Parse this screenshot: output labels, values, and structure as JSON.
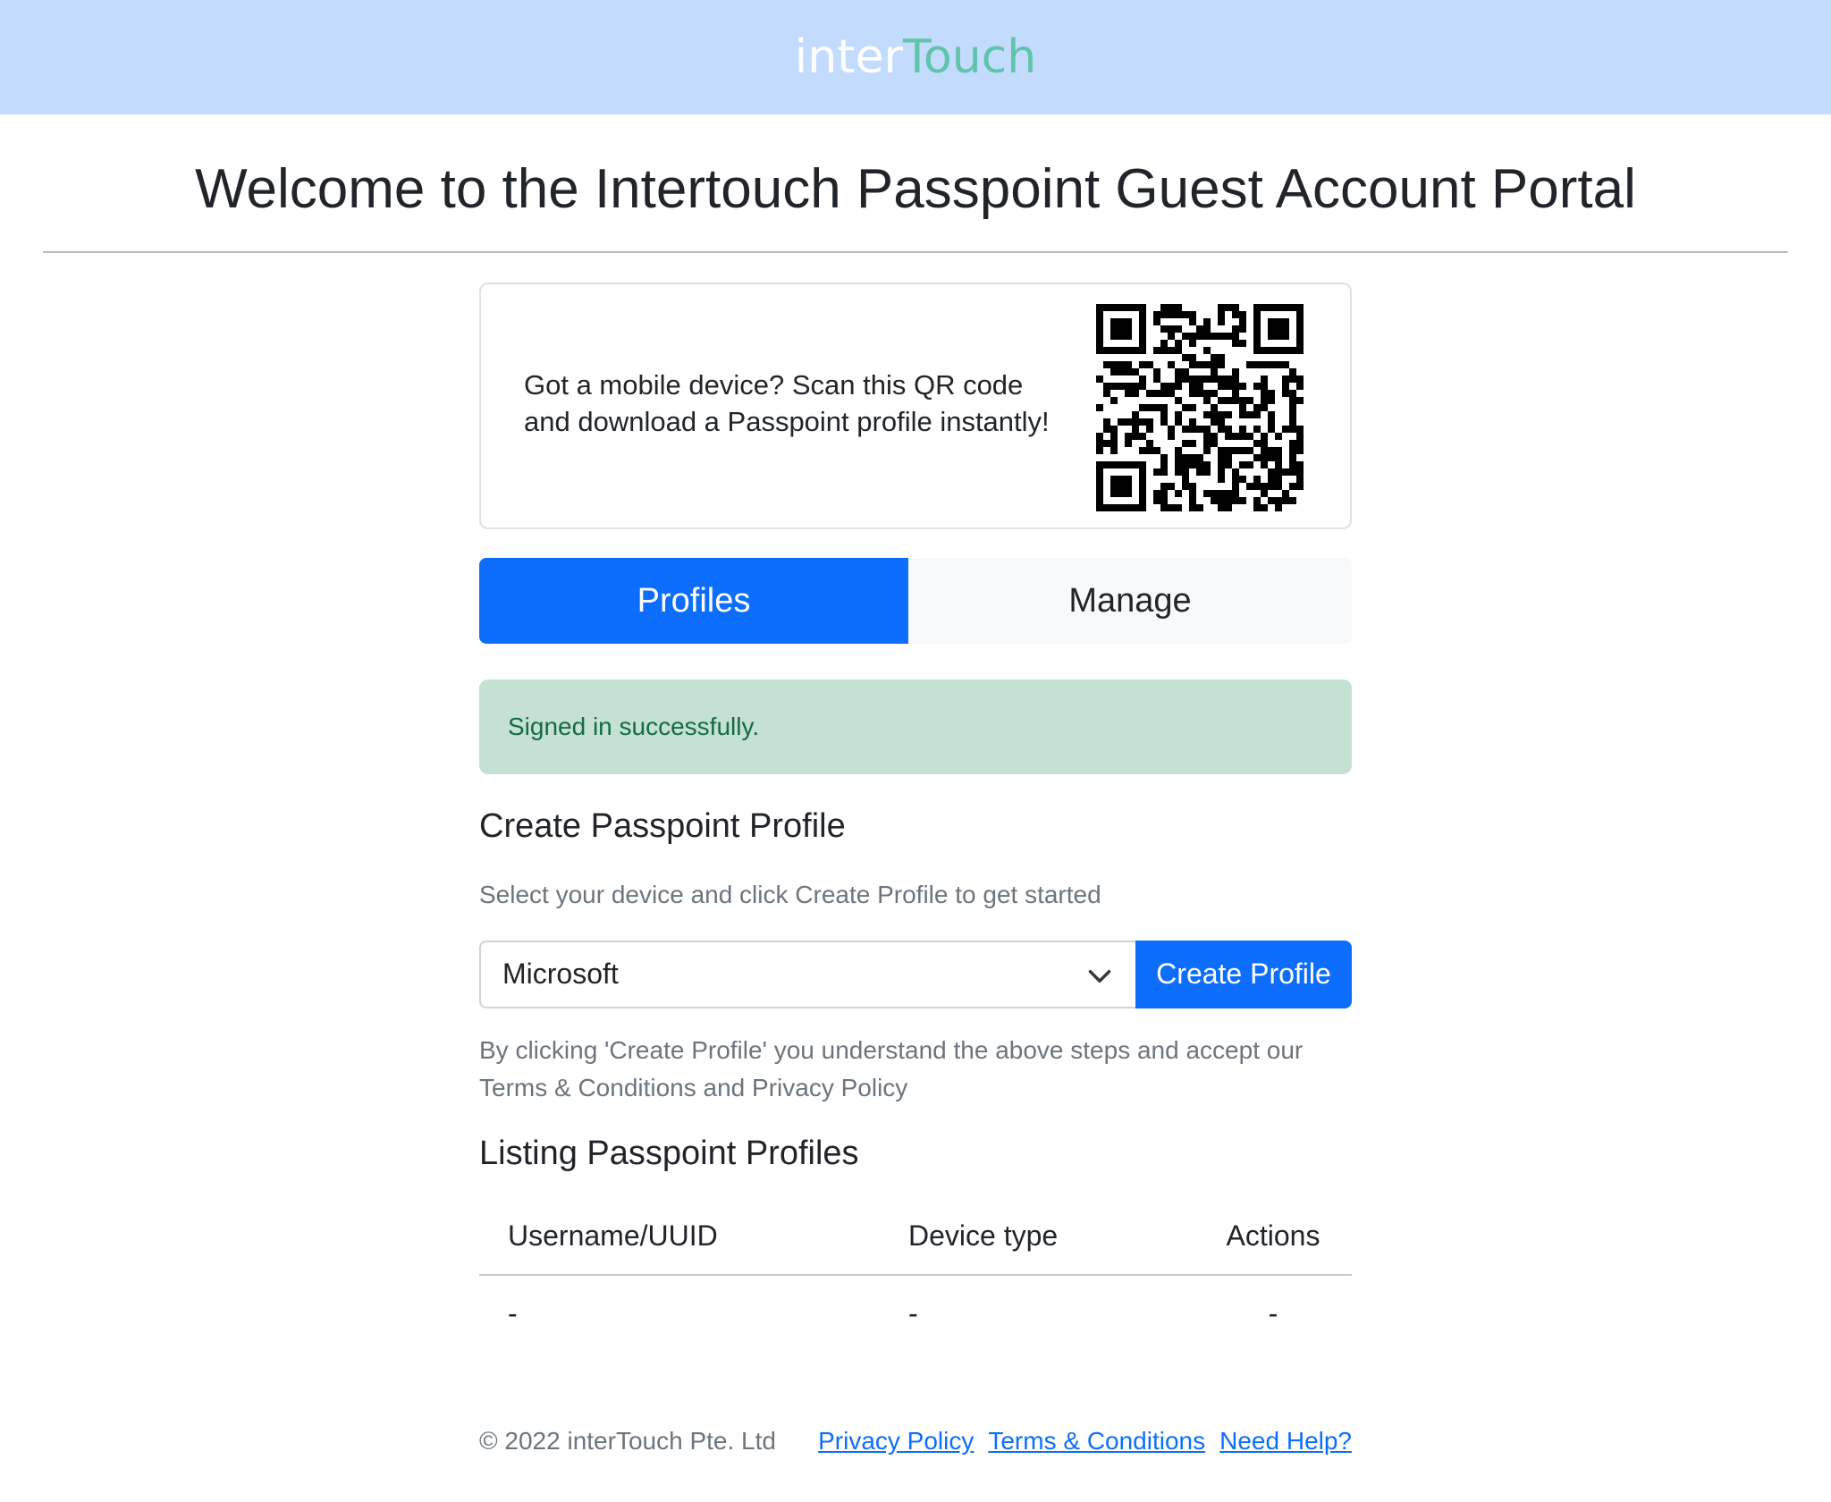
{
  "header": {
    "logo_part1": "inter",
    "logo_part2": "Touch"
  },
  "page": {
    "title": "Welcome to the Intertouch Passpoint Guest Account Portal"
  },
  "qr_card": {
    "line1": "Got a mobile device? Scan this QR code",
    "line2": "and download a Passpoint profile instantly!",
    "icon": "qr-code-icon"
  },
  "tabs": [
    {
      "label": "Profiles",
      "active": true
    },
    {
      "label": "Manage",
      "active": false
    }
  ],
  "alert": {
    "message": "Signed in successfully."
  },
  "create": {
    "heading": "Create Passpoint Profile",
    "subtitle": "Select your device and click Create Profile to get started",
    "device_select_value": "Microsoft",
    "button_label": "Create Profile",
    "terms_line1": "By clicking 'Create Profile' you understand the above steps and accept our",
    "terms_line2": "Terms & Conditions and Privacy Policy"
  },
  "listing": {
    "heading": "Listing Passpoint Profiles",
    "columns": [
      "Username/UUID",
      "Device type",
      "Actions"
    ],
    "rows": [
      [
        "-",
        "-",
        "-"
      ]
    ]
  },
  "footer": {
    "copyright": "© 2022 interTouch Pte. Ltd",
    "links": [
      "Privacy Policy",
      "Terms & Conditions",
      "Need Help?"
    ]
  },
  "colors": {
    "header_bg": "#c3dcfe",
    "brand_accent": "#5fc4a9",
    "primary": "#0d6efd",
    "alert_bg": "#c5e1d3",
    "alert_text": "#146c43"
  }
}
